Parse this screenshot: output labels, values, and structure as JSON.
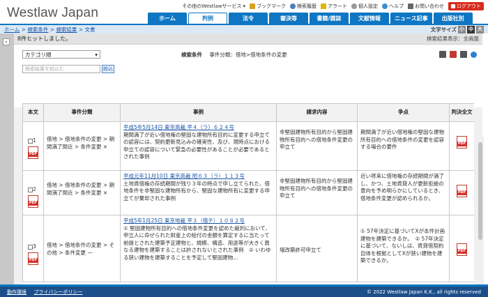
{
  "header": {
    "logo": "Westlaw Japan",
    "util": {
      "other_services": "その他のWestlawサービス",
      "bookmark": "ブックマーク",
      "history": "検索履歴",
      "alert": "アラート",
      "personal": "個人設定",
      "help": "ヘルプ",
      "contact": "お問い合わせ",
      "logout": "ログアウト"
    },
    "tabs": [
      "ホーム",
      "判例",
      "法令",
      "審決等",
      "書籍/雑誌",
      "文献情報",
      "ニュース記事",
      "出版社別"
    ]
  },
  "breadcrumb": {
    "home": "ホーム",
    "cond": "検索条件",
    "results": "検索結果",
    "current": "文書",
    "sep": ">"
  },
  "fontsize": {
    "label": "文字サイズ",
    "small": "小",
    "medium": "中",
    "large": "大"
  },
  "results": {
    "hits": "8件ヒットしました。",
    "display_label": "検索結果表示：全画面",
    "sort_value": "カテゴリ順",
    "search_cond_label": "検索条件",
    "search_cond_value": "事件分類：借地>借地条件の変更",
    "filter_placeholder": "検索結果を絞込む",
    "filter_button": "絞込"
  },
  "table": {
    "headers": [
      "本文",
      "事件分類",
      "事例",
      "請求内容",
      "争点",
      "判決全文"
    ],
    "rows": [
      {
        "num": "1",
        "category": "借地 > 借地条件の変更 > 期間満了間近 > 条件変更 ×",
        "case_link": "平成5年5月14日 東京高裁 平４（ラ）６２４号",
        "case_text": "期間満了が近い借地権の堅固な建物所有目的に変更する申立ての認容には、契約更新見込みの確実性、及び、現時点における申立ての認容について緊急の必要性があることが必要であるとされた事例",
        "claim": "非堅固建物所有目的から堅固建物所有目的への借地条件変更の申立て",
        "issue": "期間満了が近い借地権の堅固な建物所有目的への借地条件の変更を認容する場合の要件"
      },
      {
        "num": "2",
        "category": "借地 > 借地条件の変更 > 期間満了間近 > 条件変更 ×",
        "case_link": "平成元年11月10日 東京高裁 昭６３（ラ）１１３号",
        "case_text": "土地賃借権の存続期間が残り３年の時点で申し立てられた、借地条件を非堅固な建物所有から、堅固な建物所有に変更する申立てが棄却された事例",
        "claim": "非堅固建物所有目的から堅固建物所有目的への借地条件変更の申立て",
        "issue": "近い将来に借地権の存続期間が満了し、かつ、土地賃貸人が更新拒絶の意向を予め明らかにしているとき、借地条件変更が認められるか。"
      },
      {
        "num": "3",
        "category": "借地 > 借地条件の変更 > その他 > 条件変更 —",
        "case_link": "平成5年1月25日 東京地裁 平３（借チ）１０８２号",
        "case_text": "① 堅固建物所有目的への借地条件変更を認めた裁判において、申立人に命ぜられた財産上の給付の金額を算定するに当たって前提とされた建築予定建物と、規模、構造、用途等が大きく異なる建物を建築することは許されないとされた事例　② いわゆる狭い建物を建築することを予定して堅固建物...",
        "claim": "増改築許可申立て",
        "issue": "① 57年決定に基づいてXが本件計画建物を建築できるか。　② 57年決定に基づいて、ないしは、賃貸借契約自体を根拠としてXが狭い建物を建築できるか。"
      }
    ]
  },
  "footer": {
    "links": [
      "動作環境",
      "プライバシーポリシー"
    ],
    "copyright": "© 2022 Westlaw Japan K.K., all rights reserved"
  }
}
